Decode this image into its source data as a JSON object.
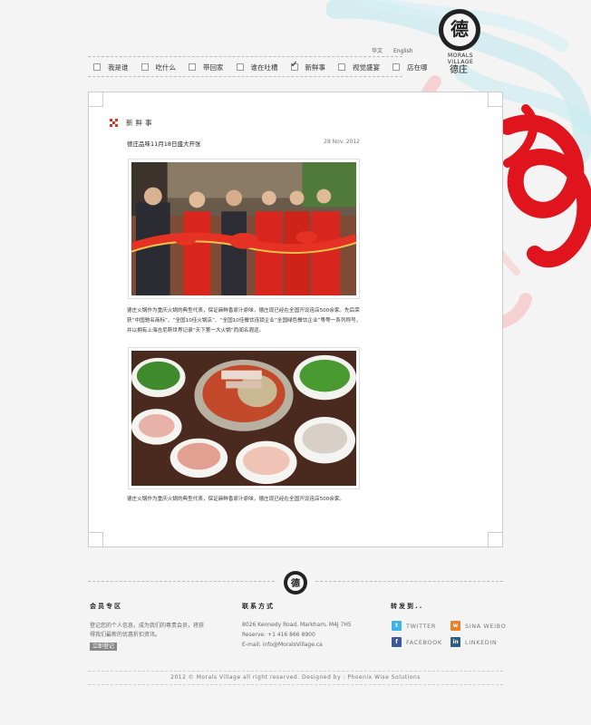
{
  "brand": {
    "logo_glyph": "德",
    "logo_text": "MORALS VILLAGE",
    "logo_signature": "德庄"
  },
  "lang": {
    "chinese": "华文",
    "english": "English"
  },
  "nav": {
    "items": [
      {
        "label": "我是谁",
        "checked": false
      },
      {
        "label": "吃什么",
        "checked": false
      },
      {
        "label": "带回家",
        "checked": false
      },
      {
        "label": "谁在吐槽",
        "checked": false
      },
      {
        "label": "新鲜事",
        "checked": true
      },
      {
        "label": "视觉盛宴",
        "checked": false
      },
      {
        "label": "店在哪",
        "checked": false
      }
    ]
  },
  "section": {
    "title": "新鲜事"
  },
  "post": {
    "title": "德庄品味11月18日盛大开张",
    "date": "28 Nov. 2012",
    "paragraph1": "德庄火锅作为重庆火锅的典型代表，保证麻鲜香原汁原味，德庄现已经在全国开设连店500余家。先后荣获“中国驰名商标”、“全国10佳火锅店”、“全国10佳餐饮连锁企业”全国绿色餐饮企业”等等一系列称号，并以拥有上海吉尼斯世界记录“天下第一大火锅”而闻名遐迩。",
    "paragraph2": "德庄火锅作为重庆火锅的典型代表，保证麻鲜香原汁原味，德庄现已经在全国开设连店500余家。"
  },
  "footer": {
    "member": {
      "heading": "会员专区",
      "text": "登记您的个人信息，成为我们的尊贵会员，将获得我们最新的优惠折扣资讯。",
      "button": "立即登记"
    },
    "contact": {
      "heading": "联系方式",
      "address": "8026 Kennedy Road, Markham, M4J 7H5",
      "reserve": "Reserve: +1 416 866 8900",
      "email": "E-mail: info@MoralsVillage.ca"
    },
    "share": {
      "heading": "转发到..",
      "twitter": "TWITTER",
      "weibo": "SINA WEIBO",
      "facebook": "FACEBOOK",
      "linkedin": "LINKEDIN"
    },
    "copyright": "2012 © Morals Village all right reserved.   Designed by : Phoenix Wise Solutions"
  },
  "colors": {
    "accent_red": "#d32f2f",
    "twitter": "#3fb3e8",
    "weibo": "#e8822d",
    "facebook": "#3b5998",
    "linkedin": "#2b5c8a"
  }
}
